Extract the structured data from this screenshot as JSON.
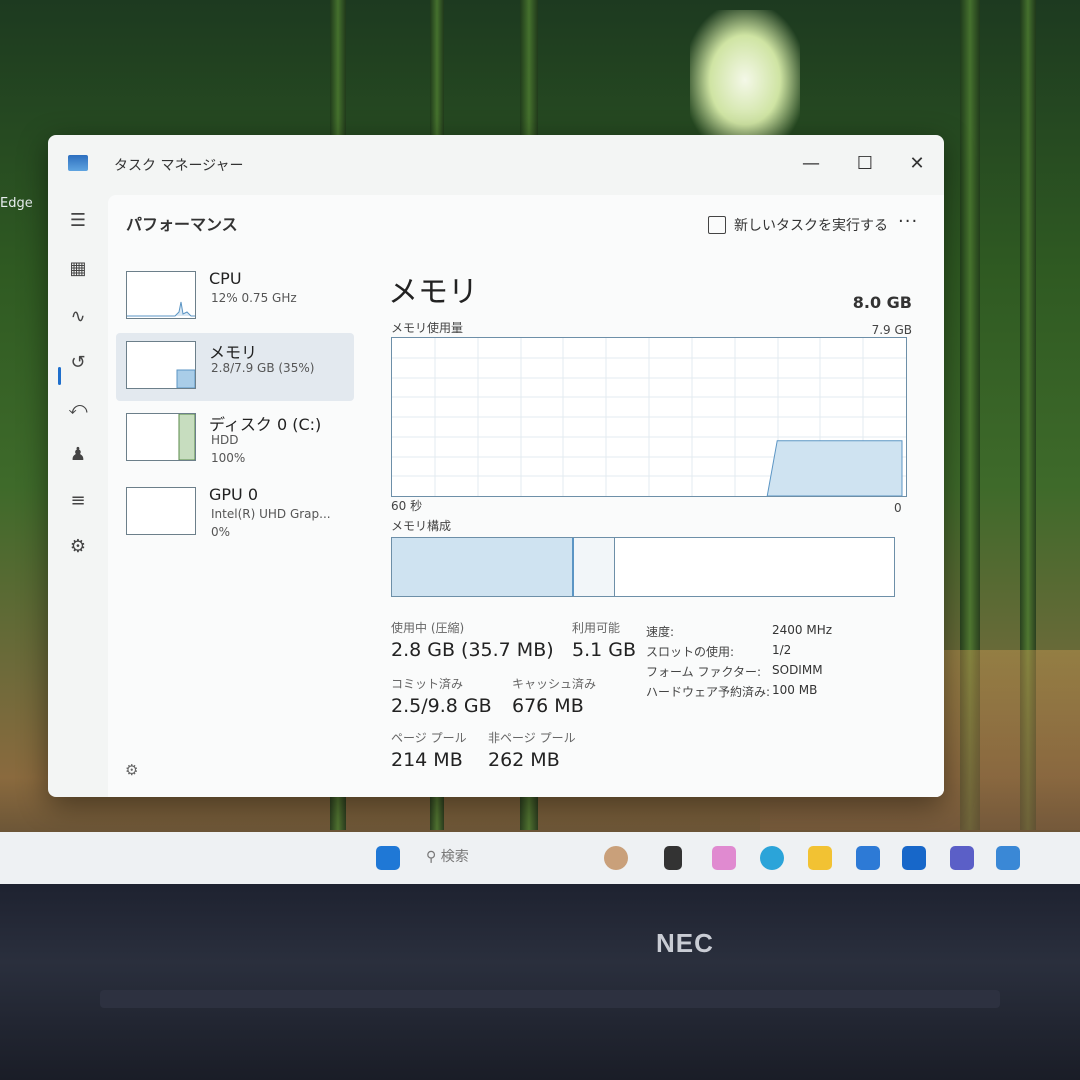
{
  "desktop": {
    "edge_label": "Edge"
  },
  "window": {
    "title": "タスク マネージャー"
  },
  "header": {
    "page_title": "パフォーマンス",
    "new_task_label": "新しいタスクを実行する"
  },
  "devices": [
    {
      "name": "CPU",
      "line1": "12%  0.75 GHz",
      "line2": ""
    },
    {
      "name": "メモリ",
      "line1": "2.8/7.9 GB (35%)",
      "line2": ""
    },
    {
      "name": "ディスク 0 (C:)",
      "line1": "HDD",
      "line2": "100%"
    },
    {
      "name": "GPU 0",
      "line1": "Intel(R) UHD Grap...",
      "line2": "0%"
    }
  ],
  "memory": {
    "title": "メモリ",
    "total": "8.0 GB",
    "usage_label": "メモリ使用量",
    "usage_max": "7.9 GB",
    "time_left": "60 秒",
    "time_right": "0",
    "composition_label": "メモリ構成",
    "in_use_label": "使用中 (圧縮)",
    "in_use_value": "2.8 GB (35.7 MB)",
    "available_label": "利用可能",
    "available_value": "5.1 GB",
    "committed_label": "コミット済み",
    "committed_value": "2.5/9.8 GB",
    "cached_label": "キャッシュ済み",
    "cached_value": "676 MB",
    "paged_label": "ページ プール",
    "paged_value": "214 MB",
    "nonpaged_label": "非ページ プール",
    "nonpaged_value": "262 MB",
    "details": [
      {
        "key": "速度:",
        "value": "2400 MHz"
      },
      {
        "key": "スロットの使用:",
        "value": "1/2"
      },
      {
        "key": "フォーム ファクター:",
        "value": "SODIMM"
      },
      {
        "key": "ハードウェア予約済み:",
        "value": "100 MB"
      }
    ],
    "usage_fraction_latest": 0.35
  },
  "taskbar": {
    "search_placeholder": "検索"
  },
  "bezel": {
    "brand": "NEC"
  },
  "colors": {
    "accent": "#1f6fcc",
    "graph_fill": "#cfe3f1",
    "graph_line": "#5b95c4"
  }
}
